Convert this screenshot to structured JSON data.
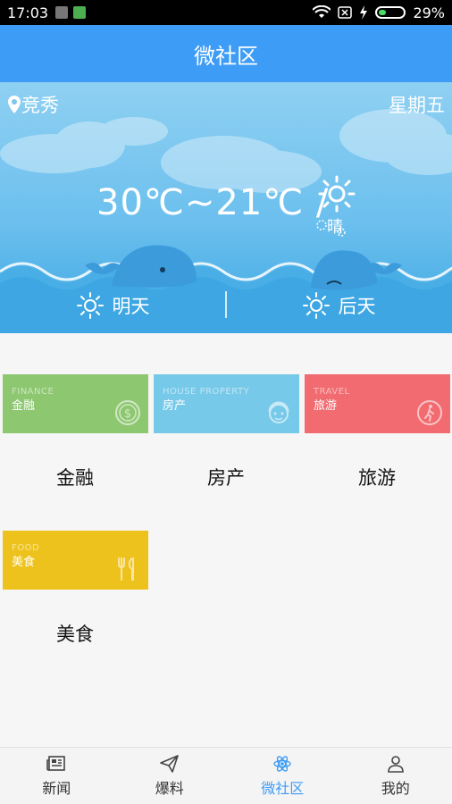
{
  "status_bar": {
    "time": "17:03",
    "battery_percent": "29%",
    "battery_level": 0.29
  },
  "app_bar": {
    "title": "微社区"
  },
  "weather": {
    "location": "竞秀",
    "weekday": "星期五",
    "temperature": "30℃~21℃ /",
    "condition": "晴",
    "tomorrow_label": "明天",
    "day_after_label": "后天"
  },
  "categories": [
    {
      "tile_en": "FINANCE",
      "tile_cn": "金融",
      "label": "金融",
      "color": "#8dc770"
    },
    {
      "tile_en": "HOUSE PROPERTY",
      "tile_cn": "房产",
      "label": "房产",
      "color": "#77c9e9"
    },
    {
      "tile_en": "TRAVEL",
      "tile_cn": "旅游",
      "label": "旅游",
      "color": "#f16b70"
    },
    {
      "tile_en": "FOOD",
      "tile_cn": "美食",
      "label": "美食",
      "color": "#eec21c"
    }
  ],
  "bottom_nav": {
    "news": "新闻",
    "report": "爆料",
    "community": "微社区",
    "mine": "我的",
    "active_color": "#3d9cf5"
  }
}
